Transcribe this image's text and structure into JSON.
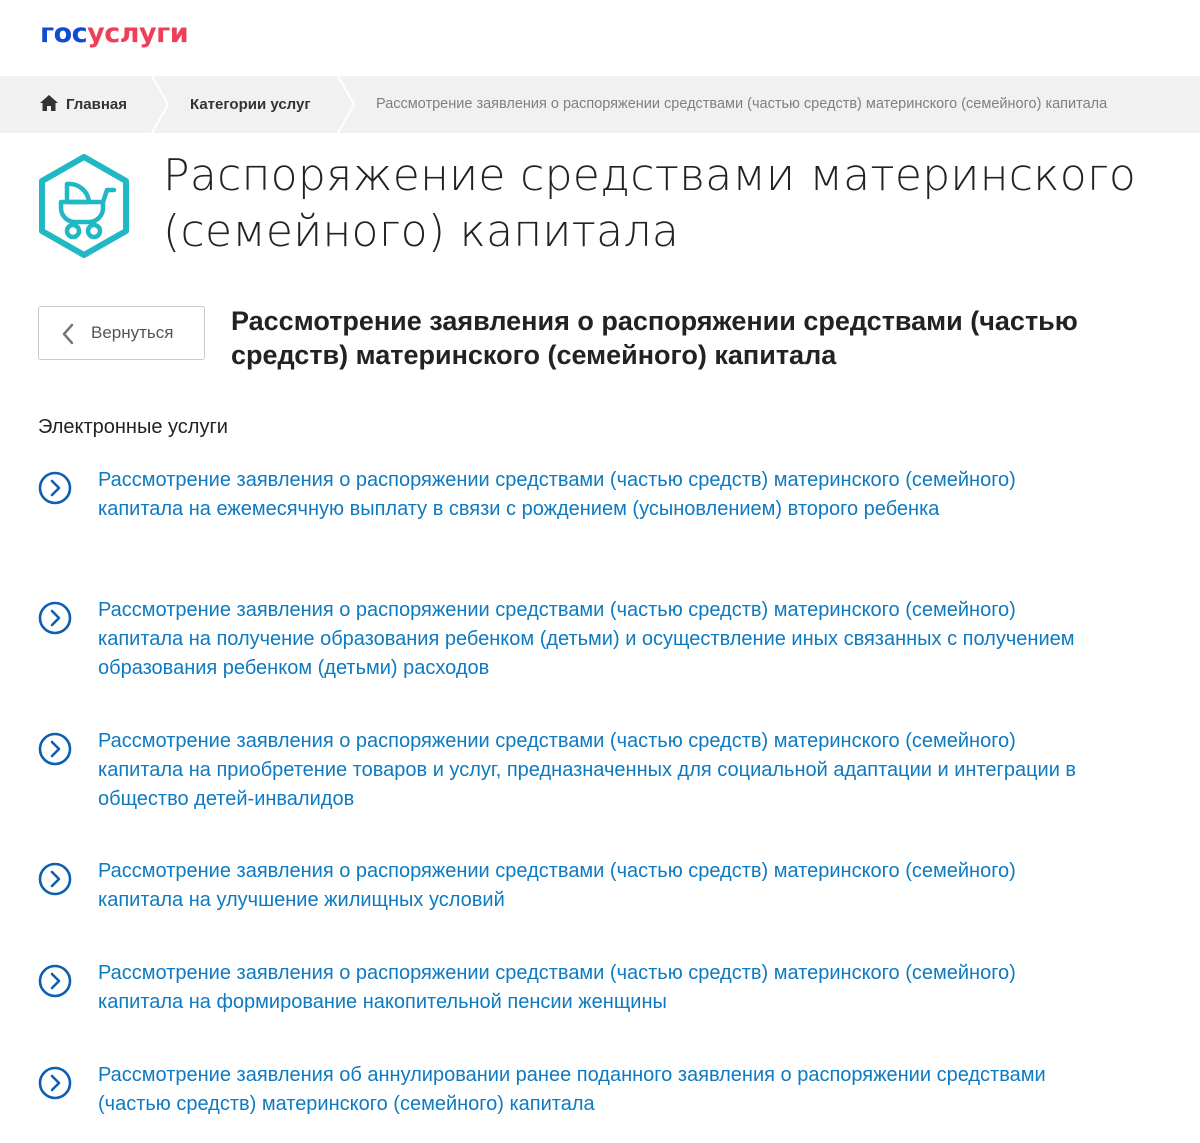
{
  "header": {
    "logo_part1": "гос",
    "logo_part2": "услуги"
  },
  "breadcrumbs": {
    "home": "Главная",
    "categories": "Категории услуг",
    "current": "Рассмотрение заявления о распоряжении средствами (частью средств) материнского (семейного) капитала"
  },
  "page": {
    "title": "Распоряжение средствами материнского (семейного) капитала",
    "back_label": "Вернуться",
    "subtitle": "Рассмотрение заявления о распоряжении средствами (частью средств) материнского (семейного) капитала",
    "section_label": "Электронные услуги"
  },
  "services": [
    {
      "label": "Рассмотрение заявления о распоряжении средствами (частью средств) материнского (семейного) капитала на ежемесячную выплату в связи с рождением (усыновлением) второго ребенка"
    },
    {
      "label": "Рассмотрение заявления о распоряжении средствами (частью средств) материнского (семейного) капитала на получение образования ребенком (детьми) и осуществление иных связанных с получением образования ребенком (детьми) расходов"
    },
    {
      "label": "Рассмотрение заявления о распоряжении средствами (частью средств) материнского (семейного) капитала на приобретение товаров и услуг, предназначенных для социальной адаптации и интеграции в общество детей-инвалидов"
    },
    {
      "label": "Рассмотрение заявления о распоряжении средствами (частью средств) материнского (семейного) капитала на улучшение жилищных условий"
    },
    {
      "label": "Рассмотрение заявления о распоряжении средствами (частью средств) материнского (семейного) капитала на формирование накопительной пенсии женщины"
    },
    {
      "label": "Рассмотрение заявления об аннулировании ранее поданного заявления о распоряжении средствами (частью средств) материнского (семейного) капитала"
    }
  ],
  "colors": {
    "logo_blue": "#0d4cd3",
    "logo_red": "#ee3f58",
    "link_blue": "#0d7ac1",
    "icon_teal": "#20b8c4",
    "breadcrumb_bg": "#f1f1f1"
  },
  "icons": {
    "home": "home-icon",
    "category": "baby-stroller-icon",
    "back": "chevron-left-icon",
    "service": "chevron-right-circle-icon"
  }
}
